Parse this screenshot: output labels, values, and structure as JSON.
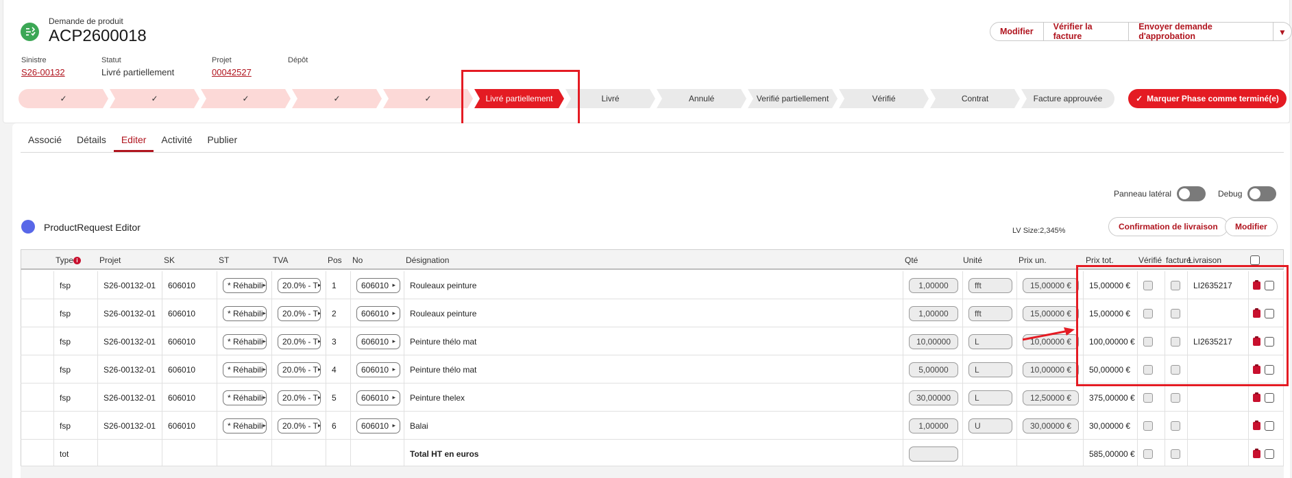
{
  "record": {
    "type_label": "Demande de produit",
    "title": "ACP2600018",
    "fields": [
      {
        "label": "Sinistre",
        "value": "S26-00132",
        "link": true
      },
      {
        "label": "Statut",
        "value": "Livré partiellement",
        "link": false
      },
      {
        "label": "Projet",
        "value": "00042527",
        "link": true
      },
      {
        "label": "Dépôt",
        "value": "",
        "link": false
      }
    ]
  },
  "actions": {
    "modifier": "Modifier",
    "verifier": "Vérifier la facture",
    "envoyer": "Envoyer demande d'approbation",
    "more": "▾"
  },
  "path": {
    "steps": [
      {
        "label": "✓",
        "state": "done"
      },
      {
        "label": "✓",
        "state": "done"
      },
      {
        "label": "✓",
        "state": "done"
      },
      {
        "label": "✓",
        "state": "done"
      },
      {
        "label": "✓",
        "state": "done"
      },
      {
        "label": "Livré partiellement",
        "state": "current"
      },
      {
        "label": "Livré",
        "state": "todo"
      },
      {
        "label": "Annulé",
        "state": "todo"
      },
      {
        "label": "Verifié partiellement",
        "state": "todo"
      },
      {
        "label": "Vérifié",
        "state": "todo"
      },
      {
        "label": "Contrat",
        "state": "todo"
      },
      {
        "label": "Facture approuvée",
        "state": "todo"
      }
    ],
    "mark_button": "Marquer Phase comme terminé(e)"
  },
  "tabs": [
    "Associé",
    "Détails",
    "Editer",
    "Activité",
    "Publier"
  ],
  "active_tab": "Editer",
  "toggles": {
    "panneau": "Panneau latéral",
    "debug": "Debug"
  },
  "editor": {
    "title": "ProductRequest Editor",
    "lv_size": "LV Size:2,345%",
    "confirm_button": "Confirmation de livraison",
    "modify_button": "Modifier"
  },
  "columns": [
    "Type",
    "Projet",
    "SK",
    "ST",
    "TVA",
    "Pos",
    "No",
    "Désignation",
    "Qté",
    "Unité",
    "Prix un.",
    "Prix tot.",
    "Vérifié",
    "facturé",
    "Livraison"
  ],
  "rows": [
    {
      "type": "fsp",
      "projet": "S26-00132-01",
      "sk": "606010",
      "st": "* Réhabili",
      "tva": "20.0% - T",
      "pos": "1",
      "no": "606010",
      "designation": "Rouleaux peinture",
      "qte": "1,00000",
      "unite": "fft",
      "prix_un": "15,00000 €",
      "prix_tot": "15,00000 €",
      "livraison": "LI2635217"
    },
    {
      "type": "fsp",
      "projet": "S26-00132-01",
      "sk": "606010",
      "st": "* Réhabili",
      "tva": "20.0% - T",
      "pos": "2",
      "no": "606010",
      "designation": "Rouleaux peinture",
      "qte": "1,00000",
      "unite": "fft",
      "prix_un": "15,00000 €",
      "prix_tot": "15,00000 €",
      "livraison": ""
    },
    {
      "type": "fsp",
      "projet": "S26-00132-01",
      "sk": "606010",
      "st": "* Réhabili",
      "tva": "20.0% - T",
      "pos": "3",
      "no": "606010",
      "designation": "Peinture thélo mat",
      "qte": "10,00000",
      "unite": "L",
      "prix_un": "10,00000 €",
      "prix_tot": "100,00000 €",
      "livraison": "LI2635217"
    },
    {
      "type": "fsp",
      "projet": "S26-00132-01",
      "sk": "606010",
      "st": "* Réhabili",
      "tva": "20.0% - T",
      "pos": "4",
      "no": "606010",
      "designation": "Peinture thélo mat",
      "qte": "5,00000",
      "unite": "L",
      "prix_un": "10,00000 €",
      "prix_tot": "50,00000 €",
      "livraison": ""
    },
    {
      "type": "fsp",
      "projet": "S26-00132-01",
      "sk": "606010",
      "st": "* Réhabili",
      "tva": "20.0% - T",
      "pos": "5",
      "no": "606010",
      "designation": "Peinture thelex",
      "qte": "30,00000",
      "unite": "L",
      "prix_un": "12,50000 €",
      "prix_tot": "375,00000 €",
      "livraison": ""
    },
    {
      "type": "fsp",
      "projet": "S26-00132-01",
      "sk": "606010",
      "st": "* Réhabili",
      "tva": "20.0% - T",
      "pos": "6",
      "no": "606010",
      "designation": "Balai",
      "qte": "1,00000",
      "unite": "U",
      "prix_un": "30,00000 €",
      "prix_tot": "30,00000 €",
      "livraison": ""
    }
  ],
  "total_row": {
    "type": "tot",
    "designation": "Total HT en euros",
    "prix_tot": "585,00000 €"
  },
  "colors": {
    "accent": "#b0141e",
    "brand_red": "#e41b23",
    "path_done": "#fcd9d7"
  }
}
